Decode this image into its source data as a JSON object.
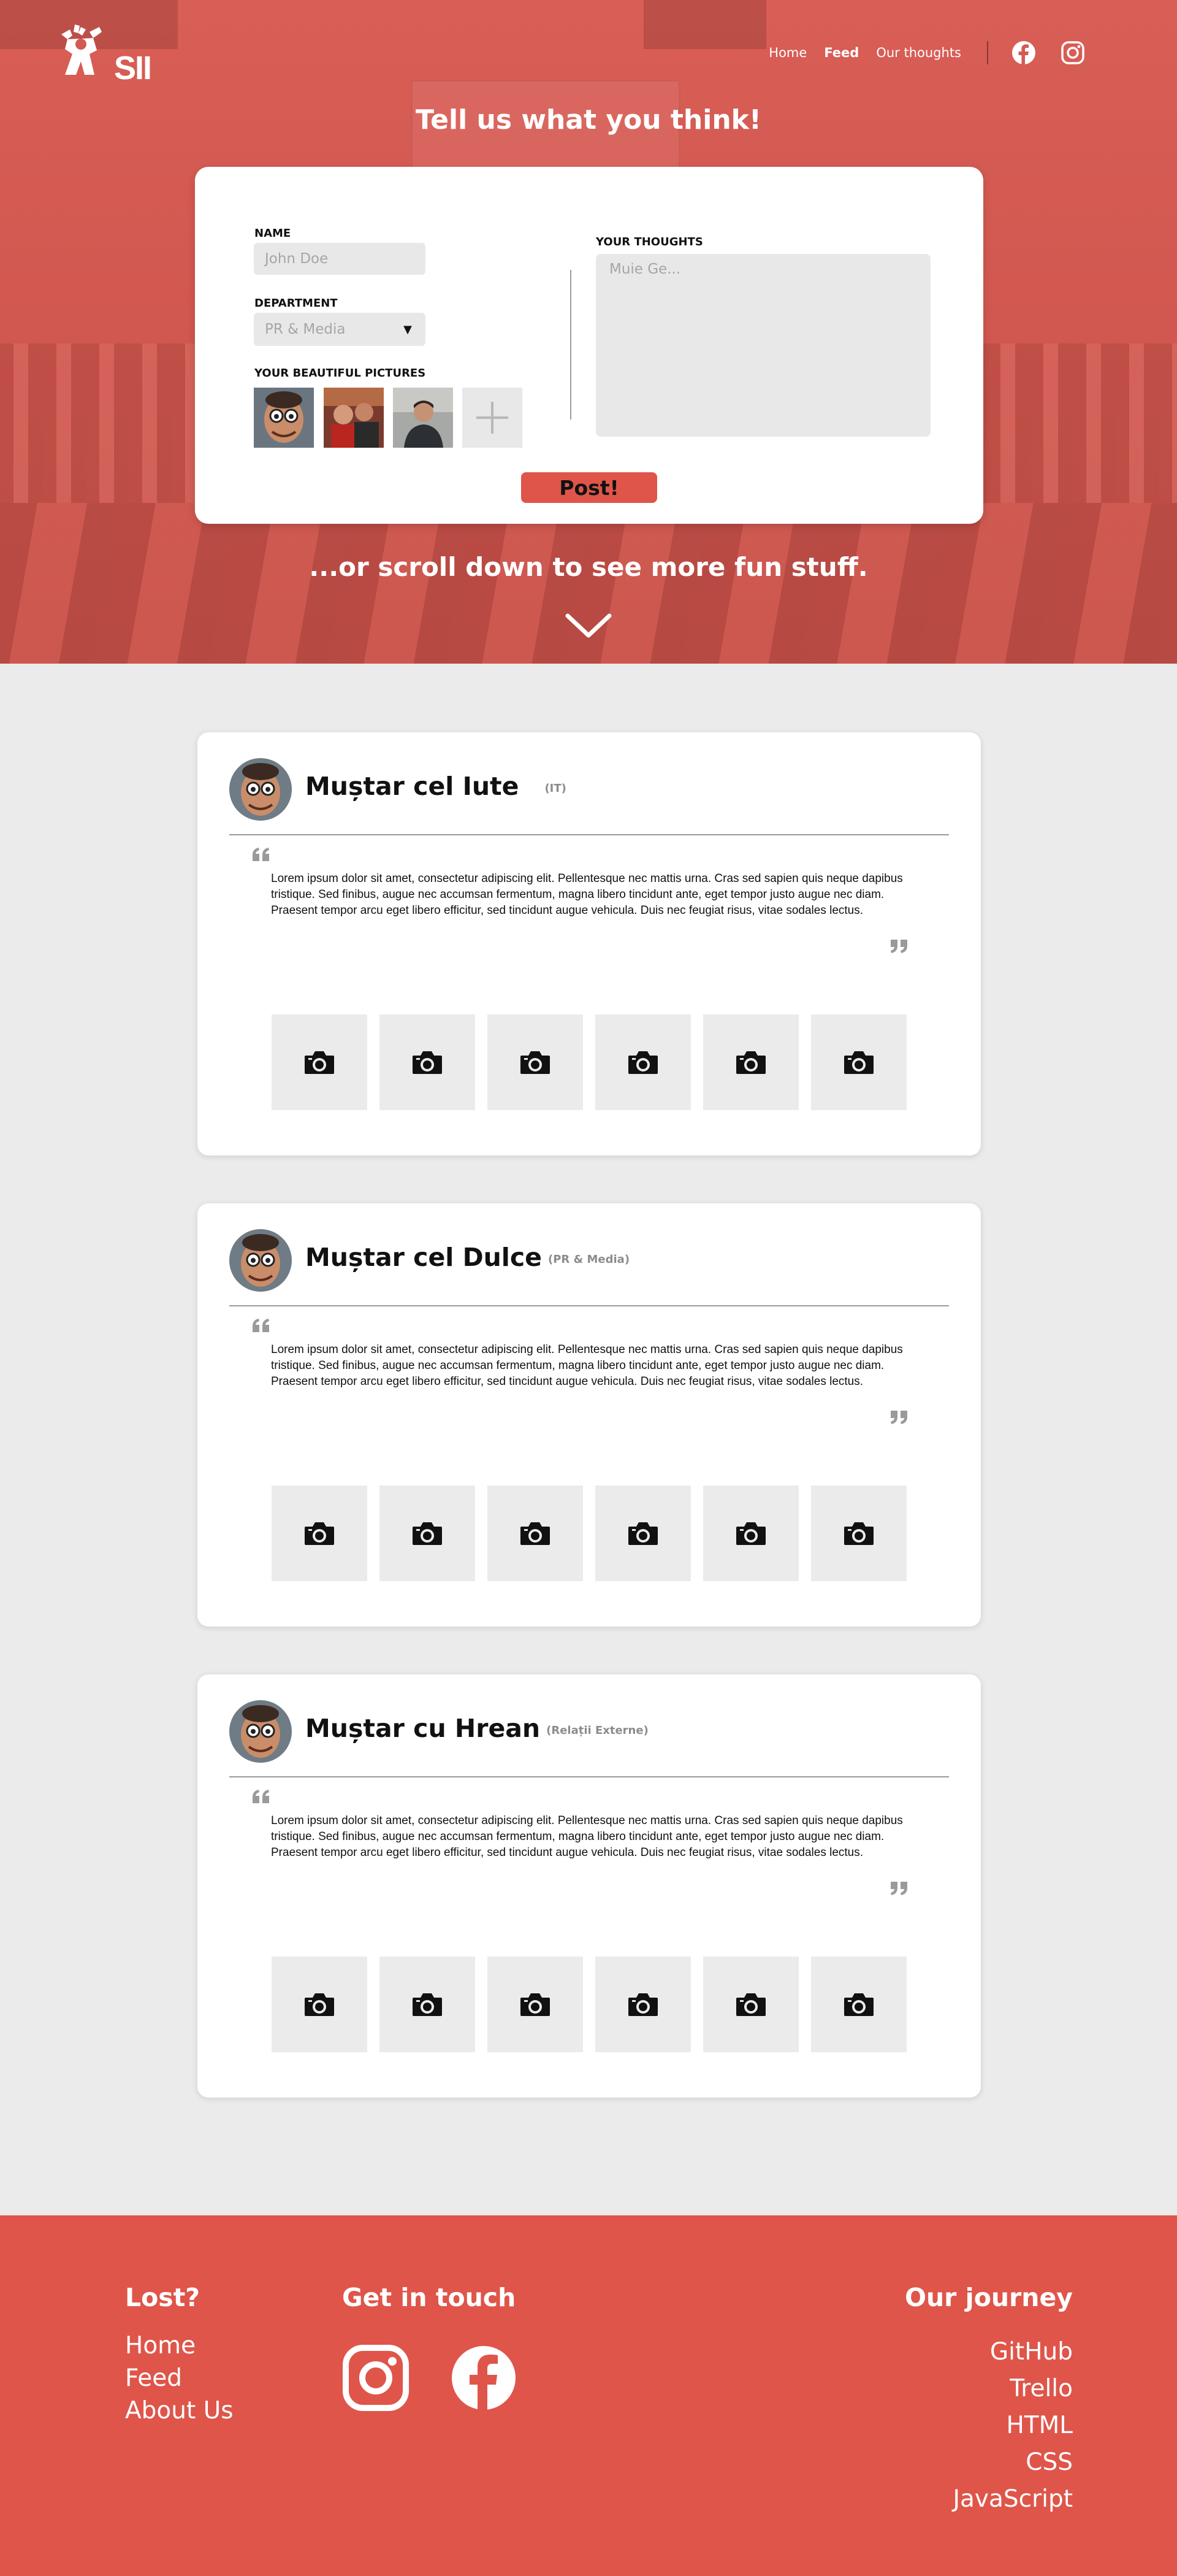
{
  "header": {
    "logo_text": "SII",
    "nav": [
      {
        "label": "Home",
        "active": false
      },
      {
        "label": "Feed",
        "active": true
      },
      {
        "label": "Our thoughts",
        "active": false
      }
    ],
    "social_icons": [
      "facebook-icon",
      "instagram-icon"
    ]
  },
  "hero": {
    "title": "Tell us what you think!",
    "subtitle": "...or scroll down to see more fun stuff.",
    "scroll_icon": "chevron-down-icon"
  },
  "form": {
    "name_label": "NAME",
    "name_placeholder": "John Doe",
    "department_label": "DEPARTMENT",
    "department_value": "PR & Media",
    "pictures_label": "YOUR BEAUTIFUL PICTURES",
    "thoughts_label": "YOUR THOUGHTS",
    "thoughts_placeholder": "Muie Ge...",
    "post_button": "Post!",
    "add_icon": "plus-icon"
  },
  "posts": [
    {
      "author": "Muștar cel Iute",
      "department": "(IT)",
      "text": "Lorem ipsum dolor sit amet, consectetur adipiscing elit. Pellentesque nec mattis urna. Cras sed sapien quis neque dapibus tristique. Sed finibus, augue nec accumsan fermentum, magna libero tincidunt ante, eget tempor justo augue nec diam. Praesent tempor arcu eget libero efficitur, sed tincidunt augue vehicula. Duis nec feugiat risus, vitae sodales lectus.",
      "photo_icon": "camera-icon"
    },
    {
      "author": "Muștar cel Dulce",
      "department": "(PR & Media)",
      "text": "Lorem ipsum dolor sit amet, consectetur adipiscing elit. Pellentesque nec mattis urna. Cras sed sapien quis neque dapibus tristique. Sed finibus, augue nec accumsan fermentum, magna libero tincidunt ante, eget tempor justo augue nec diam. Praesent tempor arcu eget libero efficitur, sed tincidunt augue vehicula. Duis nec feugiat risus, vitae sodales lectus.",
      "photo_icon": "camera-icon"
    },
    {
      "author": "Muștar cu Hrean",
      "department": "(Relații Externe)",
      "text": "Lorem ipsum dolor sit amet, consectetur adipiscing elit. Pellentesque nec mattis urna. Cras sed sapien quis neque dapibus tristique. Sed finibus, augue nec accumsan fermentum, magna libero tincidunt ante, eget tempor justo augue nec diam. Praesent tempor arcu eget libero efficitur, sed tincidunt augue vehicula. Duis nec feugiat risus, vitae sodales lectus.",
      "photo_icon": "camera-icon"
    }
  ],
  "footer": {
    "lost_heading": "Lost?",
    "lost_links": [
      "Home",
      "Feed",
      "About Us"
    ],
    "contact_heading": "Get in touch",
    "contact_icons": [
      "instagram-icon",
      "facebook-icon"
    ],
    "journey_heading": "Our journey",
    "journey_links": [
      "GitHub",
      "Trello",
      "HTML",
      "CSS",
      "JavaScript"
    ]
  },
  "colors": {
    "accent": "#df554a",
    "hero_overlay": "#d35a52",
    "page_background": "#ebebeb",
    "input_background": "#e8e8e8",
    "muted_text": "#8c8c8c"
  }
}
